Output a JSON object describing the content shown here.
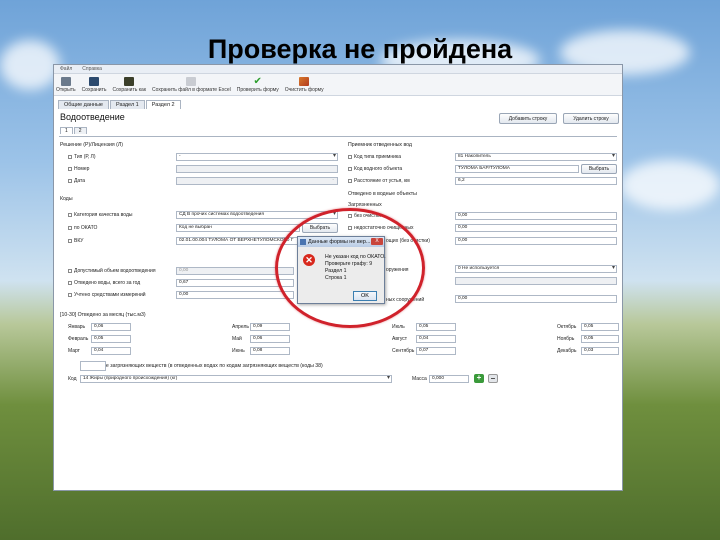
{
  "slide": {
    "title": "Проверка не пройдена"
  },
  "menubar": [
    "Файл",
    "Справка"
  ],
  "toolbar": {
    "open": "Открыть",
    "save": "Сохранить",
    "save_as": "Сохранить как",
    "save_excel": "Сохранить файл в формате Excel",
    "check": "Проверить форму",
    "clear": "Очистить форму"
  },
  "tabs": [
    "Общие данные",
    "Раздел 1",
    "Раздел 2"
  ],
  "section": {
    "title": "Водоотведение",
    "subtabs": [
      "1",
      "2"
    ],
    "add_row": "Добавить строку",
    "delete_row": "Удалить строку"
  },
  "left": {
    "decision_group": "Решение (Р)/Лицензия (Л)",
    "type_label": "Тип (Р, Л)",
    "type_value": "-",
    "number_label": "Номер",
    "date_label": "Дата",
    "date_value": "-",
    "codes_group": "Коды",
    "quality_label": "Категория качества воды",
    "quality_value": "СД В прочих системах водоотведения",
    "okato_label": "по ОКАТО",
    "okato_value": "Код не выбран",
    "okato_btn": "Выбрать",
    "vku_label": "ВКУ",
    "vku_value": "02.01.00.004 ТУЛОМА ОТ ВЕРХНЕТУЛОМСКОГО Г",
    "allowed_label": "Допустимый объем водоотведения",
    "allowed_value": "0,00",
    "total_label": "Отведено воды, всего за год",
    "total_value": "0,67",
    "measured_label": "Учтено средствами измерений",
    "measured_value": "0,00"
  },
  "right": {
    "receiver_group": "Приемник отведенных вод",
    "receiver_type_label": "Код типа приемника",
    "receiver_type_value": "81 Накопитель",
    "water_code_label": "Код водного объекта",
    "water_code_value": "ТУЛОМА БАР/ТУЛОМА",
    "water_code_btn": "Выбрать",
    "distance_label": "Расстояние от устья, км",
    "distance_value": "6,2",
    "discharged_group": "Отведено в водные объекты",
    "polluted_group": "Загрязненных",
    "no_cleaning_label": "без очистки",
    "no_cleaning_value": "0,00",
    "insufficient_label": "недостаточно очищенных",
    "insufficient_value": "0,00",
    "cleaning_partial": "ощих (без очистки)",
    "cleaning_partial_value": "0,00",
    "facility_partial": "оружения",
    "facility_value": "0 Не используется",
    "facility_extra_value": "",
    "structures_partial": "ных сооружений",
    "structures_value": "0,00"
  },
  "months": {
    "header": "[10-30] Отведено за месяц (тыс.м3)",
    "items": [
      {
        "name": "Январь",
        "value": "0,06"
      },
      {
        "name": "Февраль",
        "value": "0,05"
      },
      {
        "name": "Март",
        "value": "0,04"
      },
      {
        "name": "Апрель",
        "value": "0,09"
      },
      {
        "name": "Май",
        "value": "0,06"
      },
      {
        "name": "Июнь",
        "value": "0,08"
      },
      {
        "name": "Июль",
        "value": "0,05"
      },
      {
        "name": "Август",
        "value": "0,04"
      },
      {
        "name": "Сентябрь",
        "value": "0,07"
      },
      {
        "name": "Октябрь",
        "value": "0,05"
      },
      {
        "name": "Ноябрь",
        "value": "0,05"
      },
      {
        "name": "Декабрь",
        "value": "0,03"
      }
    ]
  },
  "pollutants": {
    "header": "не загрязняющих веществ (в отведенных водах по кодам загрязняющих веществ (коды 38)",
    "code_label": "Код",
    "code_value": "14 Жиры (природного происхождения) (кг)",
    "mass_label": "Масса",
    "mass_value": "0,000"
  },
  "dialog": {
    "title": "Данные формы не вер...",
    "close": "X",
    "lines": [
      "Не указан код по ОКАТО.",
      "Проверьте графу: 9",
      "Раздел 1",
      "Строка 1"
    ],
    "ok": "OK"
  }
}
